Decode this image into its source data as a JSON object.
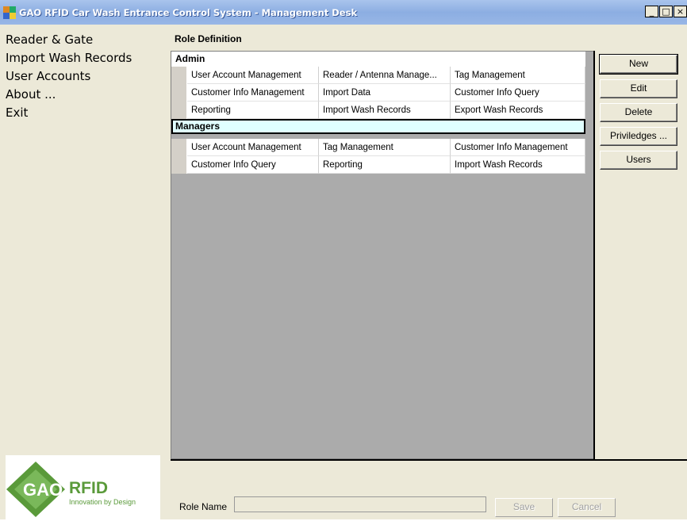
{
  "window": {
    "title": "GAO RFID Car Wash Entrance Control System - Management Desk",
    "controls": [
      "_",
      "□",
      "×"
    ]
  },
  "sidebar": {
    "items": [
      {
        "label": "Reader & Gate"
      },
      {
        "label": "Import Wash Records"
      },
      {
        "label": "User Accounts"
      },
      {
        "label": "About ..."
      },
      {
        "label": "Exit"
      }
    ],
    "logo": {
      "brand": "GAO",
      "suffix": "RFID",
      "tagline": "Innovation by Design"
    }
  },
  "main": {
    "section_title": "Role Definition",
    "groups": [
      {
        "name": "Admin",
        "rows": [
          [
            "User Account Management",
            "Reader / Antenna Manage...",
            "Tag Management"
          ],
          [
            "Customer Info Management",
            "Import Data",
            "Customer Info Query"
          ],
          [
            "Reporting",
            "Import Wash Records",
            "Export Wash Records"
          ]
        ]
      },
      {
        "name": "Managers",
        "rows": [
          [
            "User Account Management",
            "Tag Management",
            "Customer Info Management"
          ],
          [
            "Customer Info Query",
            "Reporting",
            "Import Wash Records"
          ]
        ]
      }
    ],
    "buttons": {
      "new": "New",
      "edit": "Edit",
      "delete": "Delete",
      "privileges": "Priviledges ...",
      "users": "Users"
    },
    "role_name_label": "Role Name",
    "role_name_value": "",
    "save_label": "Save",
    "cancel_label": "Cancel"
  },
  "colors": {
    "titlebar": "#8caee2",
    "selected_group": "#e0ffff",
    "logo_green": "#5a9a3a"
  }
}
